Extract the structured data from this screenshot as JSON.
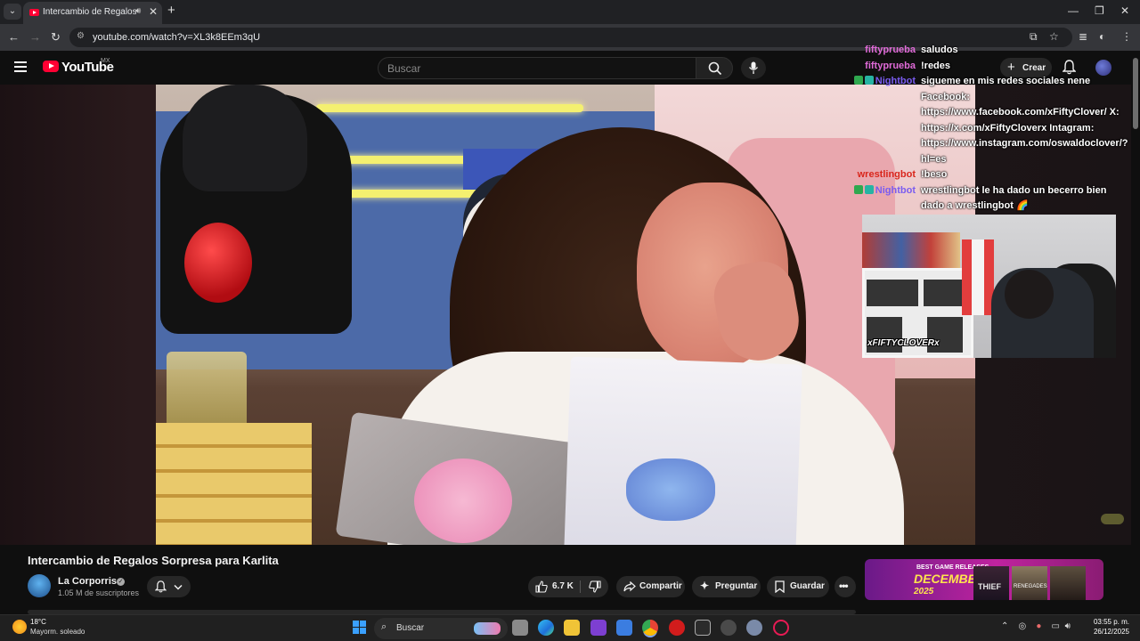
{
  "browser": {
    "tab_title": "Intercambio de Regalos Sorpresa para Karlita",
    "url": "youtube.com/watch?v=XL3k8EEm3qU"
  },
  "youtube": {
    "logo_text": "YouTube",
    "country_code": "MX",
    "search_placeholder": "Buscar",
    "create_label": "Crear"
  },
  "chat": [
    {
      "user": "fiftyprueba",
      "color": "#e06bd8",
      "badges": [],
      "text": "saludos"
    },
    {
      "user": "fiftyprueba",
      "color": "#e06bd8",
      "badges": [],
      "text": "!redes"
    },
    {
      "user": "Nightbot",
      "color": "#7a5cf0",
      "badges": [
        "check",
        "bot"
      ],
      "text": "sigueme en mis redes sociales nene Facebook: https://www.facebook.com/xFiftyClover/ X: https://x.com/xFiftyCloverx Intagram: https://www.instagram.com/oswaldoclover/?hl=es"
    },
    {
      "user": "wrestlingbot",
      "color": "#d9261c",
      "badges": [],
      "text": "!beso"
    },
    {
      "user": "Nightbot",
      "color": "#7a5cf0",
      "badges": [
        "check",
        "bot"
      ],
      "text": "wrestlingbot le ha dado un becerro bien dado a wrestlingbot 🌈"
    }
  ],
  "overlay": {
    "cam_tag": "xFIFTYCLOVERx"
  },
  "video": {
    "title": "Intercambio de Regalos Sorpresa para Karlita",
    "channel_name": "La Corporrisa",
    "subscribers": "1.05 M de suscriptores",
    "likes": "6.7 K",
    "share_label": "Compartir",
    "ask_label": "Preguntar",
    "save_label": "Guardar"
  },
  "ad": {
    "kicker": "BEST GAME RELEASES",
    "headline": "DECEMBER",
    "year": "2025",
    "game1": "THIEF",
    "game2": "RENEGADES"
  },
  "taskbar": {
    "temperature": "18°C",
    "weather": "Mayorm. soleado",
    "search_placeholder": "Buscar",
    "time": "03:55 p. m.",
    "date": "26/12/2025"
  },
  "colors": {
    "youtube_red": "#ff0033",
    "windows_accent": "#3aa0ff"
  }
}
